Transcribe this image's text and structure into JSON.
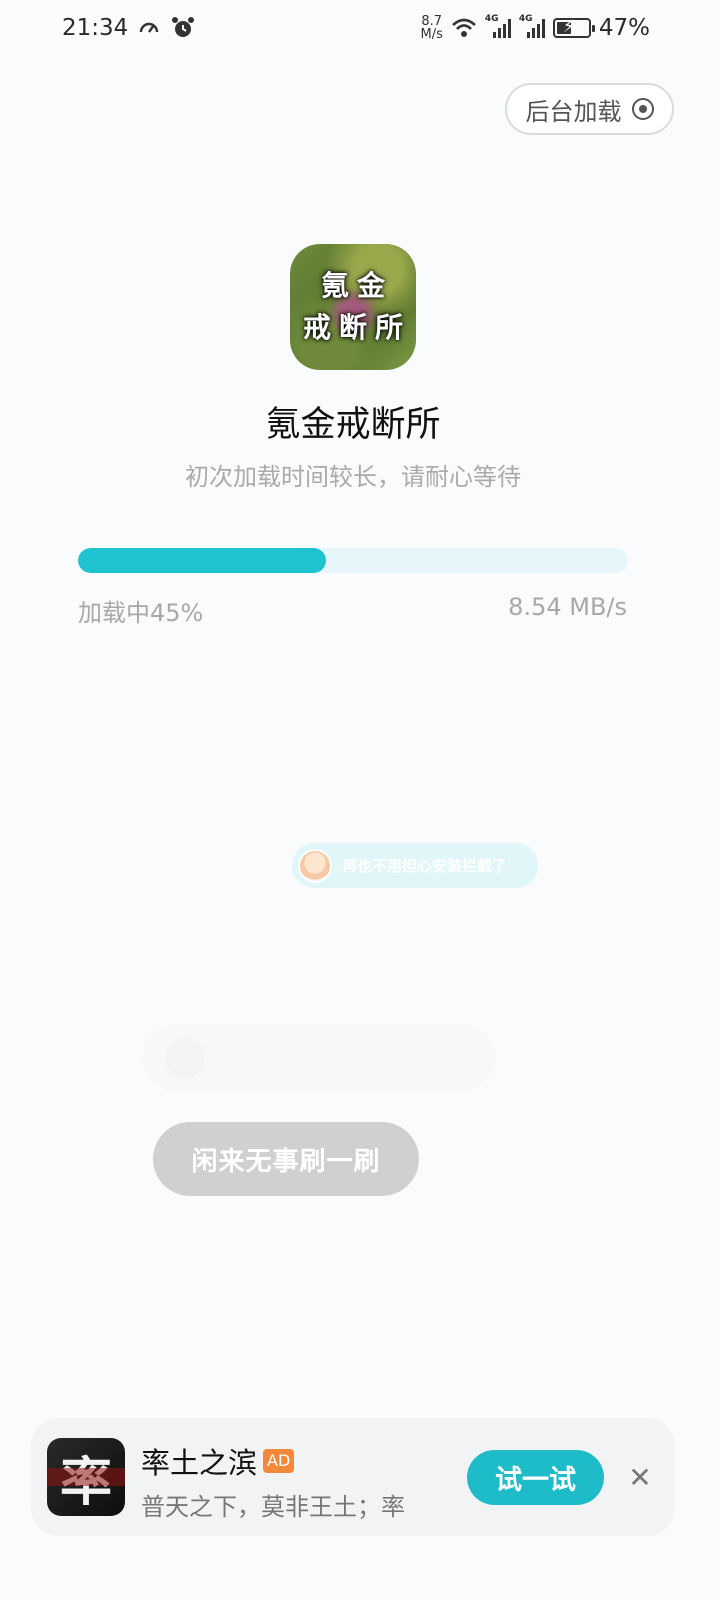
{
  "status_bar": {
    "time": "21:34",
    "net_speed_value": "8.7",
    "net_speed_unit": "M/s",
    "signal_label_1": "4G",
    "signal_label_2": "4G",
    "battery": "47%"
  },
  "header": {
    "background_load_label": "后台加载"
  },
  "app": {
    "icon_line1": "氪金",
    "icon_line2": "戒断所",
    "name": "氪金戒断所",
    "subtitle": "初次加载时间较长，请耐心等待"
  },
  "progress": {
    "percent": 45,
    "status_text": "加载中45%",
    "speed_text": "8.54 MB/s",
    "accent_color": "#1fc3cf"
  },
  "tip": {
    "text": "再也不用担心安装拦截了"
  },
  "browse_button": {
    "label": "闲来无事刷一刷"
  },
  "ad": {
    "icon_glyph": "率",
    "title": "率土之滨",
    "badge": "AD",
    "description": "普天之下，莫非王土；率",
    "cta_label": "试一试",
    "close_symbol": "✕"
  }
}
